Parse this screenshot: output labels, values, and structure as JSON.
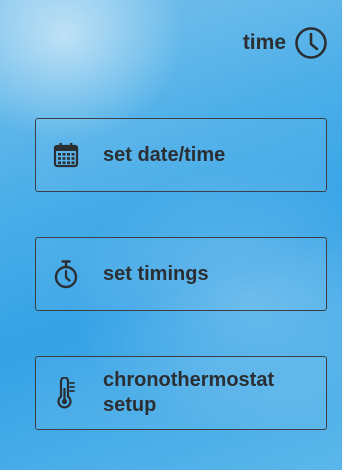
{
  "header": {
    "title": "time",
    "icon": "clock-icon"
  },
  "menu": {
    "items": [
      {
        "label": "set date/time",
        "icon": "calendar-icon"
      },
      {
        "label": "set timings",
        "icon": "stopwatch-icon"
      },
      {
        "label_line1": "chronothermostat",
        "label_line2": "setup",
        "icon": "thermometer-icon"
      }
    ]
  },
  "colors": {
    "text": "#2b2f33",
    "border": "#3a3f45",
    "background": "#4aaee8"
  }
}
